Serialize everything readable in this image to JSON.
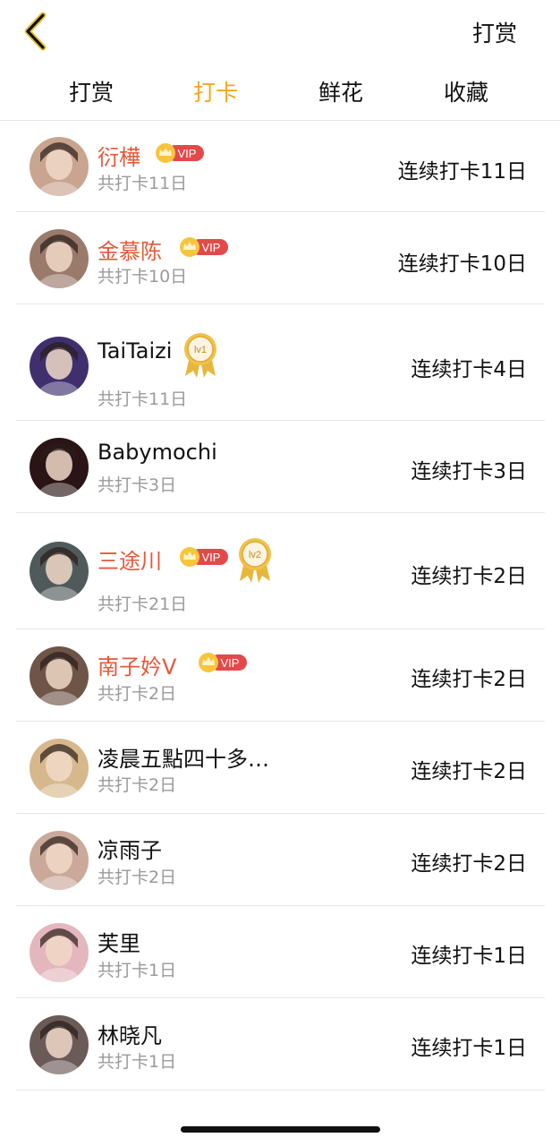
{
  "header": {
    "back_icon": "chevron-left-icon",
    "right_action": "打赏",
    "accent": "#f3a623"
  },
  "tabs": [
    {
      "label": "打赏",
      "active": false
    },
    {
      "label": "打卡",
      "active": true
    },
    {
      "label": "鲜花",
      "active": false
    },
    {
      "label": "收藏",
      "active": false
    }
  ],
  "list": [
    {
      "name": "衍樺",
      "vip": true,
      "level": null,
      "total": "共打卡11日",
      "streak": "连续打卡11日",
      "avatar_color": "#c9a48f"
    },
    {
      "name": "金慕陈",
      "vip": true,
      "level": null,
      "total": "共打卡10日",
      "streak": "连续打卡10日",
      "avatar_color": "#9a7a6b"
    },
    {
      "name": "TaiTaizi",
      "vip": false,
      "level": "lv1",
      "total": "共打卡11日",
      "streak": "连续打卡4日",
      "avatar_color": "#3f2f6e"
    },
    {
      "name": "Babymochi",
      "vip": false,
      "level": null,
      "total": "共打卡3日",
      "streak": "连续打卡3日",
      "avatar_color": "#2a1416"
    },
    {
      "name": "三途川",
      "vip": true,
      "level": "lv2",
      "total": "共打卡21日",
      "streak": "连续打卡2日",
      "avatar_color": "#505a5a"
    },
    {
      "name": "南子妗V",
      "vip": true,
      "level": null,
      "total": "共打卡2日",
      "streak": "连续打卡2日",
      "avatar_color": "#6e5548"
    },
    {
      "name": "凌晨五點四十多…",
      "vip": false,
      "level": null,
      "total": "共打卡2日",
      "streak": "连续打卡2日",
      "avatar_color": "#d7b88c"
    },
    {
      "name": "凉雨子",
      "vip": false,
      "level": null,
      "total": "共打卡2日",
      "streak": "连续打卡2日",
      "avatar_color": "#caa89a"
    },
    {
      "name": "芙里",
      "vip": false,
      "level": null,
      "total": "共打卡1日",
      "streak": "连续打卡1日",
      "avatar_color": "#e3b7bd"
    },
    {
      "name": "林晓凡",
      "vip": false,
      "level": null,
      "total": "共打卡1日",
      "streak": "连续打卡1日",
      "avatar_color": "#6a5a58"
    }
  ]
}
